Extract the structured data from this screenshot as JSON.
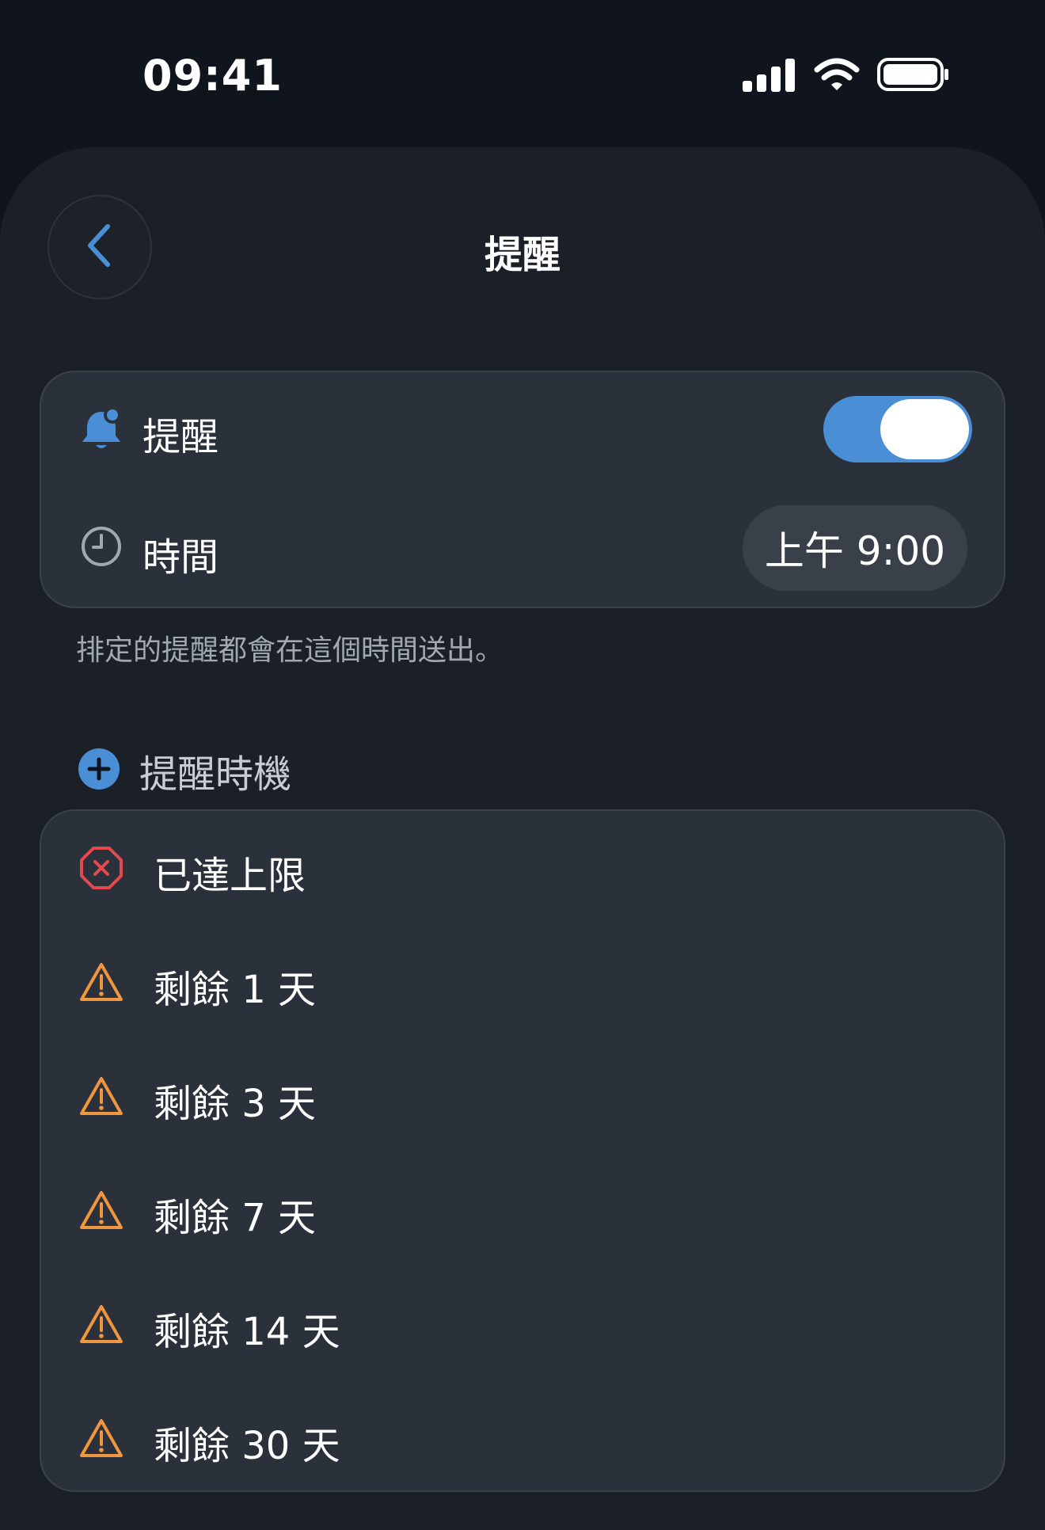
{
  "status_bar": {
    "time": "09:41",
    "icons": [
      "signal-icon",
      "wifi-icon",
      "battery-icon"
    ]
  },
  "header": {
    "title": "提醒",
    "back_icon": "chevron-left-icon"
  },
  "settings": {
    "reminder_label": "提醒",
    "reminder_enabled": true,
    "time_label": "時間",
    "time_value": "上午 9:00"
  },
  "footnote": "排定的提醒都會在這個時間送出。",
  "timing_section": {
    "title": "提醒時機"
  },
  "timing_items": [
    {
      "label": "已達上限",
      "icon": "x-octagon-icon"
    },
    {
      "label": "剩餘 1 天",
      "icon": "warning-icon"
    },
    {
      "label": "剩餘 3 天",
      "icon": "warning-icon"
    },
    {
      "label": "剩餘 7 天",
      "icon": "warning-icon"
    },
    {
      "label": "剩餘 14 天",
      "icon": "warning-icon"
    },
    {
      "label": "剩餘 30 天",
      "icon": "warning-icon"
    }
  ],
  "colors": {
    "accent": "#4a8fd6",
    "danger": "#e5484d",
    "warning": "#f0963c",
    "card": "#2b313b",
    "sheet": "#1b1f26"
  }
}
